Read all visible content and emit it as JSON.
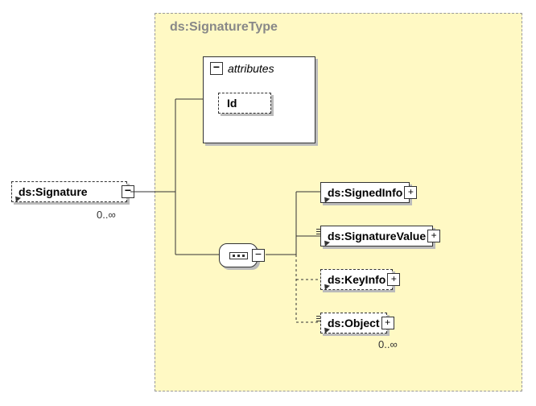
{
  "type_label": "ds:SignatureType",
  "root": {
    "label": "ds:Signature",
    "cardinality": "0..∞"
  },
  "attributes": {
    "header": "attributes",
    "id_label": "Id"
  },
  "children": [
    {
      "label": "ds:SignedInfo"
    },
    {
      "label": "ds:SignatureValue"
    },
    {
      "label": "ds:KeyInfo"
    },
    {
      "label": "ds:Object",
      "cardinality": "0..∞"
    }
  ]
}
